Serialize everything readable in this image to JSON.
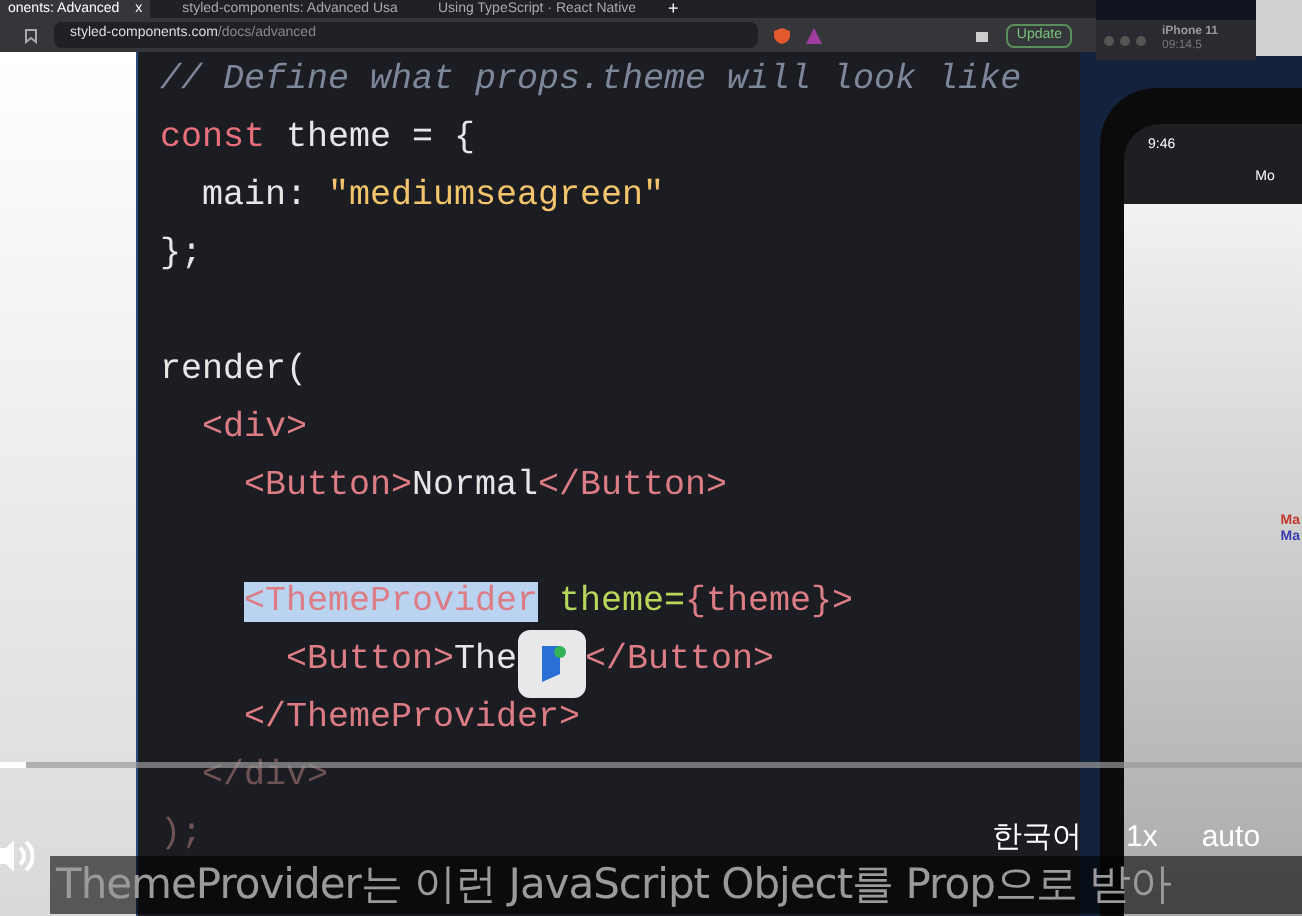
{
  "browser": {
    "tabs": [
      {
        "label": "onents: Advanced",
        "selected": true,
        "close": "x"
      },
      {
        "label": "styled-components: Advanced Usa",
        "selected": false
      },
      {
        "label": "Using TypeScript · React Native",
        "selected": false
      }
    ],
    "new_tab": "+",
    "address": {
      "host": "styled-components.com",
      "path": "/docs/advanced"
    },
    "update_button": "Update"
  },
  "code": [
    {
      "kind": "top",
      "tokens": [
        {
          "t": "// Define what props.theme will look like",
          "kind": "comment"
        }
      ]
    },
    {
      "kind": "top",
      "tokens": [
        {
          "t": "const",
          "kind": "keyword"
        },
        {
          "t": " theme = {",
          "kind": "plain"
        }
      ]
    },
    {
      "kind": "level_1",
      "tokens": [
        {
          "t": "main: ",
          "kind": "plain"
        },
        {
          "t": "\"mediumseagreen\"",
          "kind": "string"
        }
      ]
    },
    {
      "kind": "top",
      "tokens": [
        {
          "t": "};",
          "kind": "plain"
        }
      ]
    },
    {
      "kind": "blank"
    },
    {
      "kind": "top",
      "tokens": [
        {
          "t": "render(",
          "kind": "plain"
        }
      ]
    },
    {
      "kind": "level_1",
      "tokens": [
        {
          "t": "<div>",
          "kind": "tag"
        }
      ]
    },
    {
      "kind": "level_2",
      "tokens": [
        {
          "t": "<Button>",
          "kind": "tag"
        },
        {
          "t": "Normal",
          "kind": "plain"
        },
        {
          "t": "</Button>",
          "kind": "tag"
        }
      ]
    },
    {
      "kind": "blank"
    },
    {
      "kind": "level_2",
      "tokens": [
        {
          "t": "<ThemeProvider",
          "kind": "selected"
        },
        {
          "t": " theme=",
          "kind": "attr"
        },
        {
          "t": "{theme}>",
          "kind": "tag"
        }
      ]
    },
    {
      "kind": "covered",
      "tokens": [
        {
          "t": "<Button>",
          "kind": "tag"
        },
        {
          "t": "The",
          "kind": "plain"
        }
      ],
      "after": [
        {
          "t": "</Button>",
          "kind": "tag"
        }
      ]
    },
    {
      "kind": "level_2",
      "tokens": [
        {
          "t": "</ThemeProvider>",
          "kind": "tag"
        }
      ]
    },
    {
      "kind": "level_1",
      "tokens": [
        {
          "t": "</div>",
          "kind": "faded"
        }
      ]
    },
    {
      "kind": "top",
      "tokens": [
        {
          "t": ");",
          "kind": "faded"
        }
      ]
    }
  ],
  "simulator": {
    "title": "iPhone 11",
    "subtitle": "09:14.5",
    "time": "9:46",
    "nav_title": "Mo",
    "texts": [
      {
        "t": "Ma",
        "color": "#c0392b"
      },
      {
        "t": "Ma",
        "color": "#3b3bb0"
      }
    ]
  },
  "player": {
    "progress": {
      "level": 0.02
    },
    "caption": "ThemeProvider는 이런 JavaScript Object를 Prop으로 받아",
    "language": "한국어",
    "speed": "1x",
    "quality": "auto"
  }
}
